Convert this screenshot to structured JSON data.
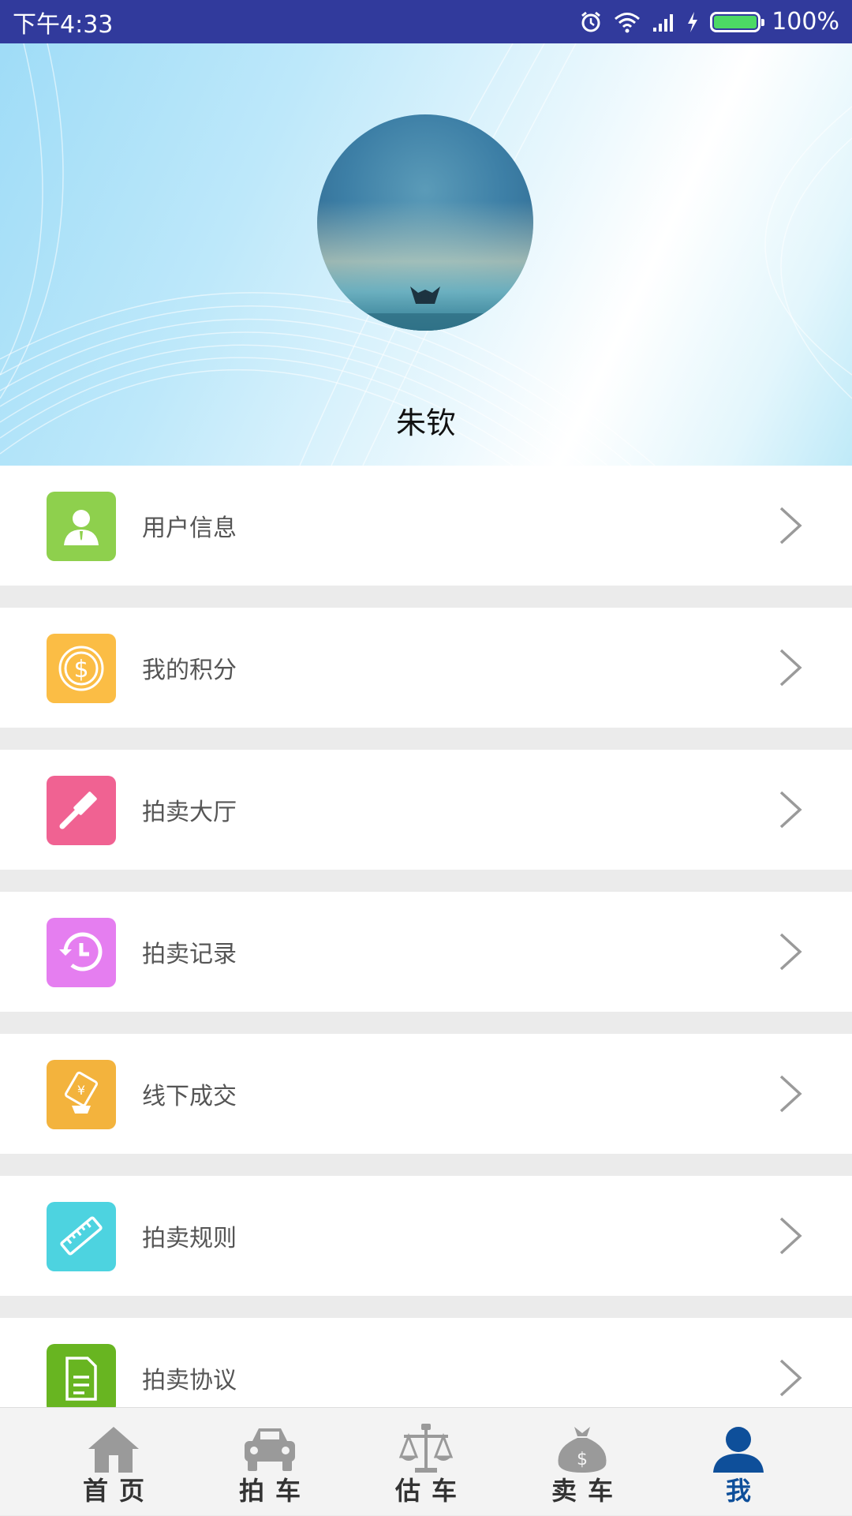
{
  "status_bar": {
    "time": "下午4:33",
    "battery": "100%"
  },
  "profile": {
    "name": "朱钦"
  },
  "menu": [
    {
      "label": "用户信息",
      "icon": "user-info-icon",
      "color": "#8ed04d"
    },
    {
      "label": "我的积分",
      "icon": "coin-icon",
      "color": "#fbbd45"
    },
    {
      "label": "拍卖大厅",
      "icon": "gavel-icon",
      "color": "#f06292"
    },
    {
      "label": "拍卖记录",
      "icon": "history-clock-icon",
      "color": "#e57ef0"
    },
    {
      "label": "线下成交",
      "icon": "deal-ticket-icon",
      "color": "#f3b33d"
    },
    {
      "label": "拍卖规则",
      "icon": "ruler-icon",
      "color": "#4dd3e0"
    },
    {
      "label": "拍卖协议",
      "icon": "document-icon",
      "color": "#68b521"
    }
  ],
  "bottom_nav": [
    {
      "label": "首页",
      "icon": "home-icon",
      "active": false
    },
    {
      "label": "拍车",
      "icon": "car-icon",
      "active": false
    },
    {
      "label": "估车",
      "icon": "scale-icon",
      "active": false
    },
    {
      "label": "卖车",
      "icon": "money-bag-icon",
      "active": false
    },
    {
      "label": "我",
      "icon": "person-icon",
      "active": true
    }
  ],
  "colors": {
    "status_bar": "#313a9c",
    "active_nav": "#0e4f9a",
    "inactive_nav": "#333333"
  }
}
